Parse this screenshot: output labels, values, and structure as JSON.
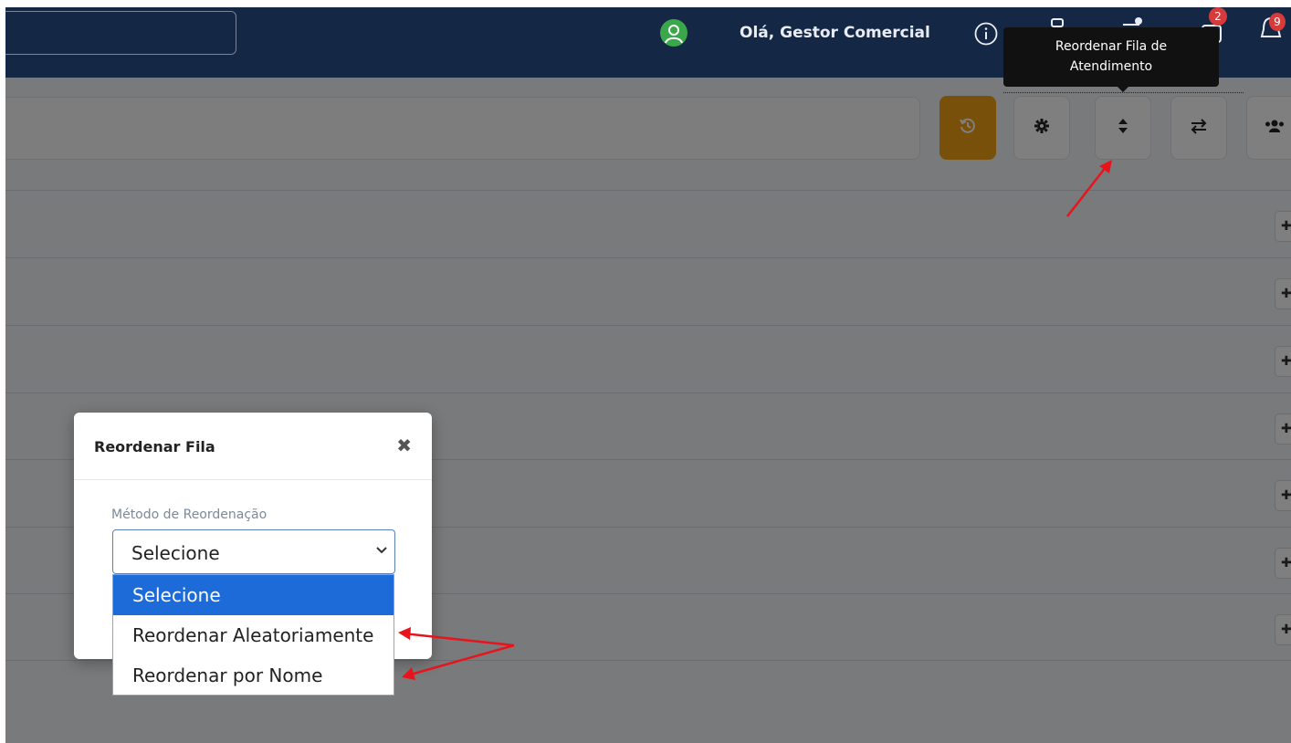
{
  "header": {
    "greeting": "Olá, Gestor Comercial",
    "badges": {
      "tasks": "2",
      "notifications": "9"
    }
  },
  "toolbar": {
    "tooltip": "Reordenar Fila de Atendimento",
    "icons": [
      "history-icon",
      "gear-icon",
      "sort-icon",
      "swap-icon",
      "users-icon"
    ]
  },
  "modal": {
    "title": "Reordenar Fila",
    "close": "✖",
    "field_label": "Método de Reordenação",
    "select_value": "Selecione",
    "options": [
      "Selecione",
      "Reordenar Aleatoriamente",
      "Reordenar por Nome"
    ]
  },
  "colors": {
    "topbar": "#142744",
    "accent_orange": "#f0a012",
    "selected_option": "#1c6bd9",
    "annotation": "#e8141c"
  }
}
